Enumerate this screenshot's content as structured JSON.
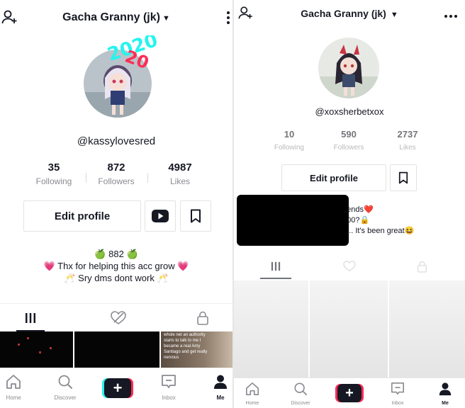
{
  "left": {
    "username_title": "Gacha Granny (jk)",
    "avatar_sticker_text": "2020",
    "handle": "@kassylovesred",
    "stats": [
      {
        "num": "35",
        "label": "Following"
      },
      {
        "num": "872",
        "label": "Followers"
      },
      {
        "num": "4987",
        "label": "Likes"
      }
    ],
    "edit_profile_label": "Edit profile",
    "bio_lines": [
      "🍏 882 🍏",
      "💗 Thx for helping this acc grow 💗",
      "🥂 Sry dms dont work 🥂"
    ],
    "grid_caption": "whole net an authority starts to talk to me I became a real Amy Santiago and get really nervous"
  },
  "right": {
    "username_title": "Gacha Granny (jk)",
    "handle": "@xoxsherbetxox",
    "stats": [
      {
        "num": "10",
        "label": "Following"
      },
      {
        "num": "590",
        "label": "Followers"
      },
      {
        "num": "2737",
        "label": "Likes"
      }
    ],
    "edit_profile_label": "Edit profile",
    "bio_lines": [
      "riends❤️",
      "600?🔒",
      "n... It's been great😆"
    ]
  },
  "nav": {
    "home": "Home",
    "discover": "Discover",
    "plus": "+",
    "inbox": "Inbox",
    "me": "Me"
  },
  "colors": {
    "text": "#161823",
    "muted": "#8a8b91",
    "cyan": "#25f4ee",
    "red": "#fe2c55",
    "heart": "#fe2c55"
  }
}
